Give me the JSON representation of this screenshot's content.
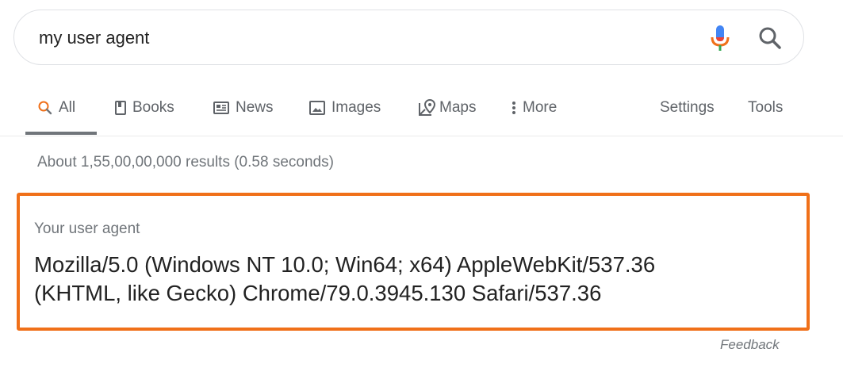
{
  "search": {
    "query": "my user agent"
  },
  "tabs": [
    {
      "label": "All",
      "icon": "search-icon",
      "active": true
    },
    {
      "label": "Books",
      "icon": "book-icon"
    },
    {
      "label": "News",
      "icon": "newspaper-icon"
    },
    {
      "label": "Images",
      "icon": "image-icon"
    },
    {
      "label": "Maps",
      "icon": "map-pin-icon"
    },
    {
      "label": "More",
      "icon": "more-vert-icon"
    }
  ],
  "tools": {
    "settings_label": "Settings",
    "tools_label": "Tools"
  },
  "results": {
    "stats": "About 1,55,00,00,000 results (0.58 seconds)"
  },
  "answer": {
    "label": "Your user agent",
    "line1": "Mozilla/5.0 (Windows NT 10.0; Win64; x64) AppleWebKit/537.36",
    "line2": "(KHTML, like Gecko) Chrome/79.0.3945.130 Safari/537.36",
    "highlight_color": "#f07019"
  },
  "feedback": {
    "label": "Feedback"
  }
}
